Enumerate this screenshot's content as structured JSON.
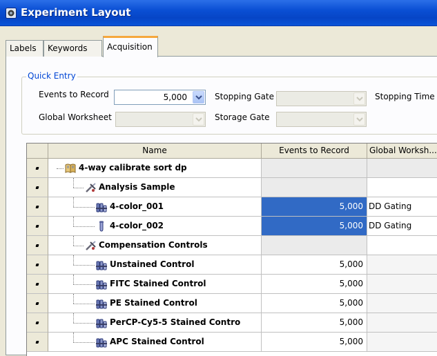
{
  "window": {
    "title": "Experiment Layout"
  },
  "tabs": [
    {
      "label": "Labels",
      "active": false
    },
    {
      "label": "Keywords",
      "active": false
    },
    {
      "label": "Acquisition",
      "active": true
    }
  ],
  "quick_entry": {
    "legend": "Quick Entry",
    "events_to_record_label": "Events to Record",
    "events_to_record_value": "5,000",
    "stopping_gate_label": "Stopping Gate",
    "stopping_gate_value": "",
    "stopping_time_label": "Stopping Time",
    "global_worksheet_label": "Global Worksheet",
    "global_worksheet_value": "",
    "storage_gate_label": "Storage Gate",
    "storage_gate_value": ""
  },
  "grid": {
    "columns": [
      "Name",
      "Events to Record",
      "Global Worksh..."
    ],
    "rows": [
      {
        "name": "4-way calibrate sort dp",
        "icon": "experiment-book-icon",
        "level": 0,
        "events": "",
        "worksheet": "",
        "events_style": "grey",
        "ws_style": "grey"
      },
      {
        "name": "Analysis Sample",
        "icon": "specimen-icon",
        "level": 1,
        "events": "",
        "worksheet": "",
        "events_style": "grey",
        "ws_style": "plain"
      },
      {
        "name": "4-color_001",
        "icon": "tube-rack-icon",
        "level": 2,
        "events": "5,000",
        "worksheet": "DD Gating",
        "events_style": "selected",
        "ws_style": "plain"
      },
      {
        "name": "4-color_002",
        "icon": "tube-icon",
        "level": 2,
        "events": "5,000",
        "worksheet": "DD Gating",
        "events_style": "selected",
        "ws_style": "plain"
      },
      {
        "name": "Compensation Controls",
        "icon": "specimen-icon",
        "level": 1,
        "events": "",
        "worksheet": "",
        "events_style": "grey",
        "ws_style": "plain"
      },
      {
        "name": "Unstained Control",
        "icon": "tube-rack-icon",
        "level": 2,
        "events": "5,000",
        "worksheet": "",
        "events_style": "plain",
        "ws_style": "readonly"
      },
      {
        "name": "FITC Stained Control",
        "icon": "tube-rack-icon",
        "level": 2,
        "events": "5,000",
        "worksheet": "",
        "events_style": "plain",
        "ws_style": "readonly"
      },
      {
        "name": "PE Stained Control",
        "icon": "tube-rack-icon",
        "level": 2,
        "events": "5,000",
        "worksheet": "",
        "events_style": "plain",
        "ws_style": "readonly"
      },
      {
        "name": "PerCP-Cy5-5 Stained Contro",
        "icon": "tube-rack-icon",
        "level": 2,
        "events": "5,000",
        "worksheet": "",
        "events_style": "plain",
        "ws_style": "readonly"
      },
      {
        "name": "APC Stained Control",
        "icon": "tube-rack-icon",
        "level": 2,
        "events": "5,000",
        "worksheet": "",
        "events_style": "plain",
        "ws_style": "readonly"
      }
    ]
  },
  "colors": {
    "selection": "#316ac5",
    "tab_highlight": "#f6a73c",
    "titlebar": "#0a4fd4",
    "legend": "#0046d5"
  }
}
